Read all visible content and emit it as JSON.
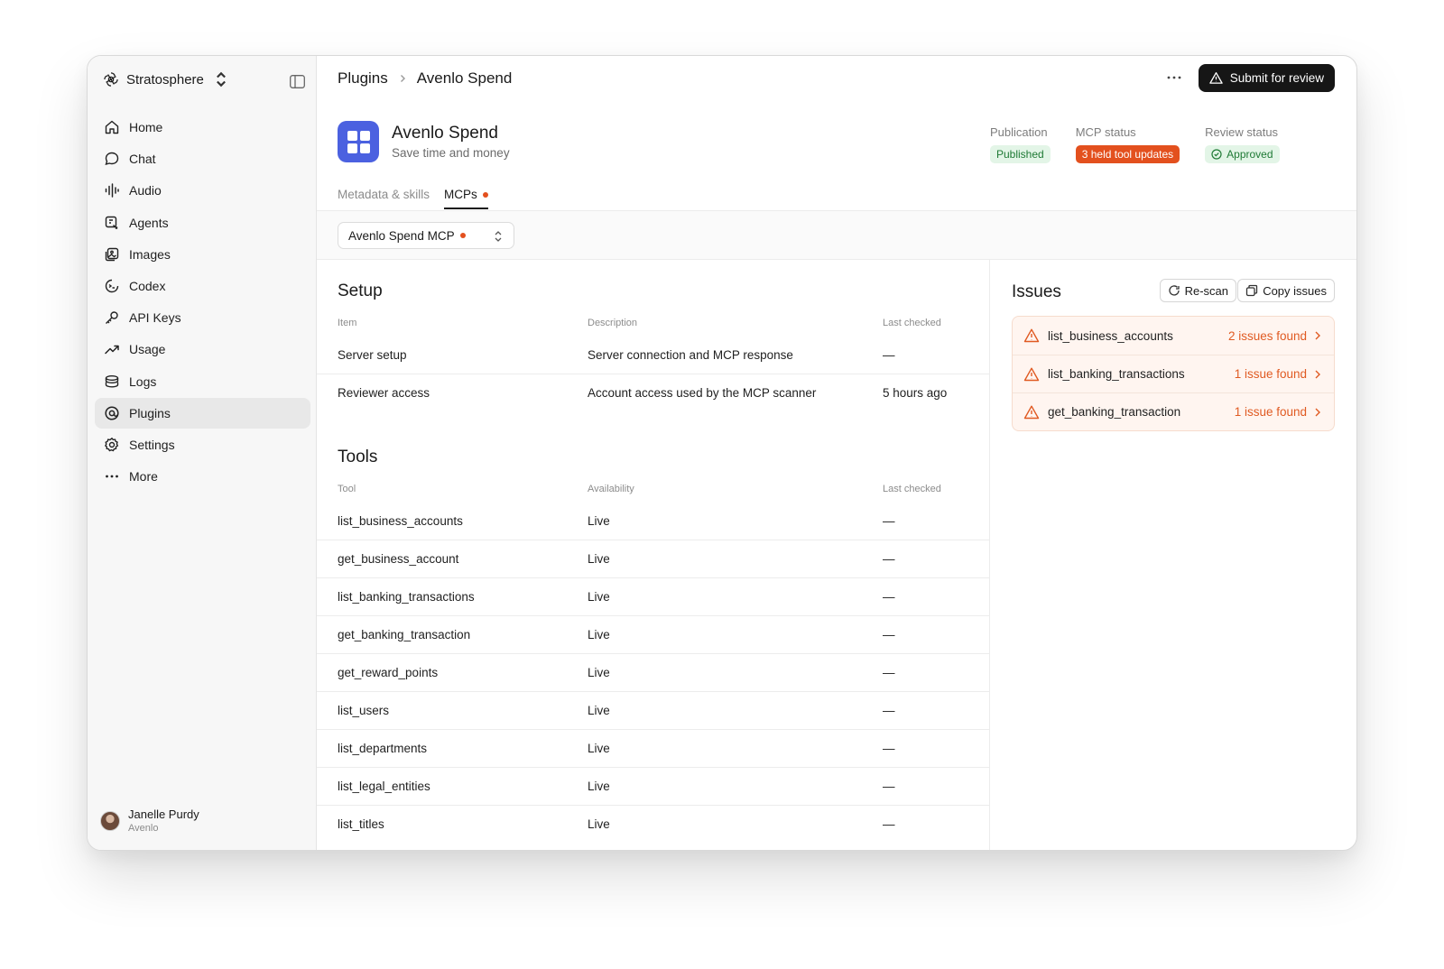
{
  "workspace": {
    "name": "Stratosphere"
  },
  "nav": [
    {
      "label": "Home",
      "icon": "home-icon"
    },
    {
      "label": "Chat",
      "icon": "chat-icon"
    },
    {
      "label": "Audio",
      "icon": "audio-icon"
    },
    {
      "label": "Agents",
      "icon": "agents-icon"
    },
    {
      "label": "Images",
      "icon": "images-icon"
    },
    {
      "label": "Codex",
      "icon": "codex-icon"
    },
    {
      "label": "API Keys",
      "icon": "key-icon"
    },
    {
      "label": "Usage",
      "icon": "usage-icon"
    },
    {
      "label": "Logs",
      "icon": "logs-icon"
    },
    {
      "label": "Plugins",
      "icon": "plugins-icon",
      "active": true
    },
    {
      "label": "Settings",
      "icon": "gear-icon"
    },
    {
      "label": "More",
      "icon": "more-icon"
    }
  ],
  "user": {
    "name": "Janelle Purdy",
    "org": "Avenlo"
  },
  "breadcrumb": {
    "parent": "Plugins",
    "current": "Avenlo Spend"
  },
  "actions": {
    "submit_label": "Submit for review"
  },
  "plugin": {
    "name": "Avenlo Spend",
    "subtitle": "Save time and money"
  },
  "status": {
    "publication_label": "Publication",
    "publication_value": "Published",
    "mcp_label": "MCP status",
    "mcp_value": "3 held tool updates",
    "review_label": "Review status",
    "review_value": "Approved"
  },
  "tabs": {
    "metadata": "Metadata & skills",
    "mcps": "MCPs"
  },
  "mcp_selector": {
    "value": "Avenlo Spend MCP"
  },
  "setup": {
    "title": "Setup",
    "headers": {
      "item": "Item",
      "description": "Description",
      "last_checked": "Last checked"
    },
    "rows": [
      {
        "item": "Server setup",
        "description": "Server connection and MCP response",
        "last_checked": "—"
      },
      {
        "item": "Reviewer access",
        "description": "Account access used by the MCP scanner",
        "last_checked": "5 hours ago"
      }
    ]
  },
  "tools": {
    "title": "Tools",
    "headers": {
      "tool": "Tool",
      "availability": "Availability",
      "last_checked": "Last checked"
    },
    "rows": [
      {
        "tool": "list_business_accounts",
        "availability": "Live",
        "last_checked": "—"
      },
      {
        "tool": "get_business_account",
        "availability": "Live",
        "last_checked": "—"
      },
      {
        "tool": "list_banking_transactions",
        "availability": "Live",
        "last_checked": "—"
      },
      {
        "tool": "get_banking_transaction",
        "availability": "Live",
        "last_checked": "—"
      },
      {
        "tool": "get_reward_points",
        "availability": "Live",
        "last_checked": "—"
      },
      {
        "tool": "list_users",
        "availability": "Live",
        "last_checked": "—"
      },
      {
        "tool": "list_departments",
        "availability": "Live",
        "last_checked": "—"
      },
      {
        "tool": "list_legal_entities",
        "availability": "Live",
        "last_checked": "—"
      },
      {
        "tool": "list_titles",
        "availability": "Live",
        "last_checked": "—"
      }
    ]
  },
  "issues": {
    "title": "Issues",
    "rescan_label": "Re-scan",
    "copy_label": "Copy issues",
    "items": [
      {
        "tool": "list_business_accounts",
        "count": "2 issues found"
      },
      {
        "tool": "list_banking_transactions",
        "count": "1 issue found"
      },
      {
        "tool": "get_banking_transaction",
        "count": "1 issue found"
      }
    ]
  },
  "colors": {
    "accent_orange": "#e3501e",
    "logo_blue": "#4b61e0",
    "success_green": "#1f7a35"
  }
}
